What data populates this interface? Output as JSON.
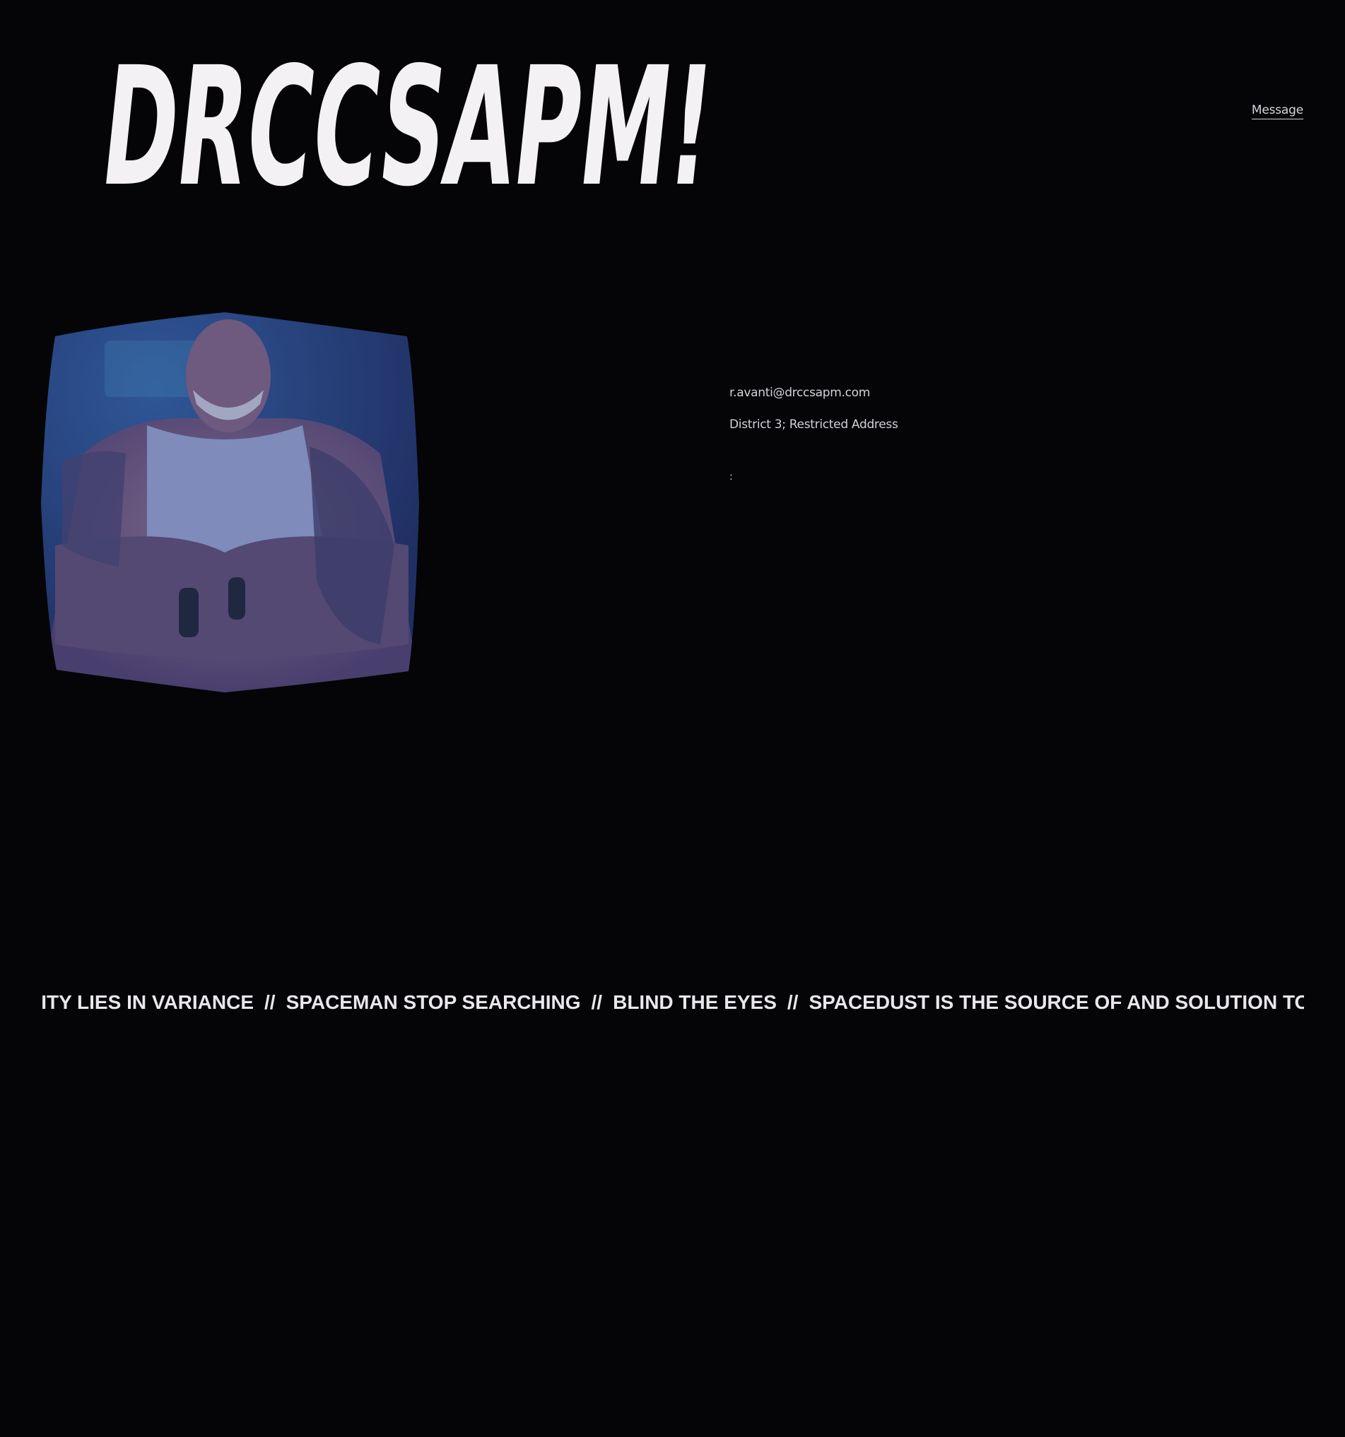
{
  "header": {
    "logo_text": "DRCCSAPM!",
    "nav_message_label": "Message"
  },
  "portrait": {
    "icon": "portrait-photo",
    "tint": "#3a4a8c"
  },
  "contact": {
    "email": "r.avanti@drccsapm.com",
    "address": "District 3; Restricted Address",
    "separator": ":"
  },
  "ticker": {
    "items": [
      "NITY LIES IN VARIANCE",
      "SPACEMAN STOP SEARCHING",
      "BLIND THE EYES",
      "SPACEDUST IS THE SOURCE OF AND SOLUTION TO ALL P"
    ],
    "separator": "//"
  },
  "colors": {
    "background": "#050407",
    "text": "#e9e6ec"
  }
}
